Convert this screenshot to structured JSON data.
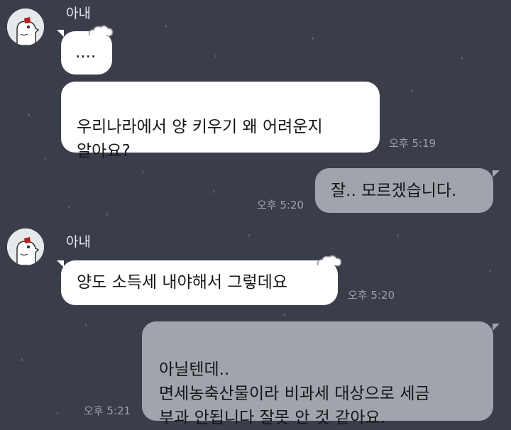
{
  "conversation": [
    {
      "sender": "아내",
      "messages": [
        {
          "text": "...."
        },
        {
          "text": "우리나라에서 양 키우기 왜 어려운지\n알아요?",
          "time": "오후 5:19"
        }
      ]
    },
    {
      "sender": "me",
      "messages": [
        {
          "text": "잘.. 모르겠습니다.",
          "time": "오후 5:20"
        }
      ]
    },
    {
      "sender": "아내",
      "messages": [
        {
          "text": "양도 소득세 내야해서 그렇데요",
          "time": "오후 5:20"
        }
      ]
    },
    {
      "sender": "me",
      "messages": [
        {
          "text": "아닐텐데..\n면세농축산물이라 비과세 대상으로 세금\n부과 안됩니다 잘못 안 것 같아요.",
          "time": "오후 5:21"
        }
      ]
    }
  ],
  "colors": {
    "background": "#3a3e4b",
    "incoming_bubble": "#ffffff",
    "outgoing_bubble": "#a1a4ad",
    "timestamp": "#9ca0aa"
  },
  "icons": {
    "avatar": "cartoon-character-avatar-icon"
  }
}
